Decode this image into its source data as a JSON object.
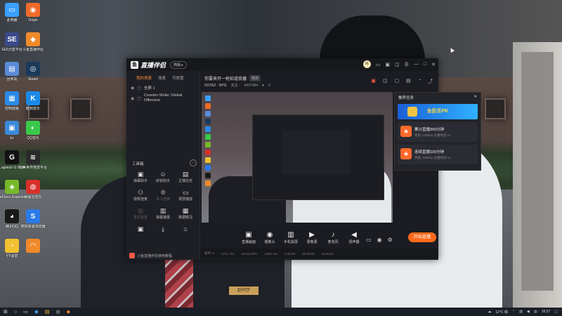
{
  "desktop_icons": [
    {
      "label": "此电脑",
      "color": "#3aa0ff",
      "glyph": "▭"
    },
    {
      "label": "Origin",
      "color": "#f06a2a",
      "glyph": "◉"
    },
    {
      "label": "SE5分盒平台",
      "color": "#3a4a8a",
      "glyph": "SE"
    },
    {
      "label": "斗鱼直播伴侣",
      "color": "#f08a2a",
      "glyph": "◆"
    },
    {
      "label": "回收站",
      "color": "#5a8ad8",
      "glyph": "▤"
    },
    {
      "label": "Steam",
      "color": "#1b3a5a",
      "glyph": "◎"
    },
    {
      "label": "控制面板",
      "color": "#2a8ae8",
      "glyph": "▦"
    },
    {
      "label": "酷狗音乐",
      "color": "#1a8ae8",
      "glyph": "K"
    },
    {
      "label": "kz",
      "color": "#3a8ad8",
      "glyph": "▣"
    },
    {
      "label": "QQ音乐",
      "color": "#3ac84a",
      "glyph": "◐"
    },
    {
      "label": "Logitech G HUB",
      "color": "#111",
      "glyph": "G"
    },
    {
      "label": "完美世界竞技平台",
      "color": "#2a2a2a",
      "glyph": "≋"
    },
    {
      "label": "GeForce Experience",
      "color": "#76b82a",
      "glyph": "◈"
    },
    {
      "label": "网易云音乐",
      "color": "#d8302a",
      "glyph": "◍"
    },
    {
      "label": "腾讯QQ",
      "color": "#1a1a1a",
      "glyph": "◕"
    },
    {
      "label": "搜狗高速浏览器",
      "color": "#2a7ae8",
      "glyph": "S"
    },
    {
      "label": "YY语音",
      "color": "#f2c030",
      "glyph": "◔"
    },
    {
      "label": "",
      "color": "#f08a2a",
      "glyph": "◠"
    }
  ],
  "app": {
    "name": "直播伴侣",
    "version_pill": "简版 ▸",
    "user_avatar": "M",
    "sidebar": {
      "tabs": [
        "我的场景",
        "场景",
        "可放置"
      ],
      "scenes": [
        {
          "label": "全屏 1"
        },
        {
          "label": "Counter-Strike: Global Offensive"
        }
      ],
      "tools_title": "工具箱",
      "tools": [
        {
          "label": "弹幕助手",
          "glyph": "▣",
          "dim": false
        },
        {
          "label": "房管助手",
          "glyph": "☺",
          "dim": false
        },
        {
          "label": "主播任务",
          "glyph": "▤",
          "dim": false
        },
        {
          "label": "视频连麦",
          "glyph": "⚇",
          "dim": false
        },
        {
          "label": "多人连麦",
          "glyph": "⚉",
          "dim": true
        },
        {
          "label": "录屏播放",
          "glyph": "▭",
          "dim": false
        },
        {
          "label": "进行投票",
          "glyph": "◎",
          "dim": true
        },
        {
          "label": "弹幕播报",
          "glyph": "▥",
          "dim": false
        },
        {
          "label": "数据概况",
          "glyph": "▦",
          "dim": false
        },
        {
          "label": "",
          "glyph": "▣",
          "dim": false
        },
        {
          "label": "",
          "glyph": "⤓",
          "dim": false
        },
        {
          "label": "",
          "glyph": "⌂",
          "dim": false
        }
      ],
      "notice": "斗鱼直播伴侣使用教程"
    },
    "main": {
      "room_title": "你要来开一枪知道我播",
      "room_tag": "修改",
      "game": "DOTA2 - RPG",
      "followers": "关注 ·",
      "fans_count": "6497384",
      "likes": "0"
    },
    "tasks": {
      "title": "推荐任务",
      "banner_text": "全民乐PK",
      "items": [
        {
          "title": "累计直播300分钟",
          "sub": "奖励: 1000xp 主播经验 x1"
        },
        {
          "title": "连续直播100分钟",
          "sub": "奖励: 1000xp 主播经验 x1"
        }
      ]
    },
    "sources": [
      {
        "label": "直播画面",
        "glyph": "▣"
      },
      {
        "label": "摄像头",
        "glyph": "◉"
      },
      {
        "label": "手机投屏",
        "glyph": "▥"
      },
      {
        "label": "录像源",
        "glyph": "▶"
      },
      {
        "label": "麦克风",
        "glyph": "♪"
      },
      {
        "label": "扬声器",
        "glyph": "◀"
      }
    ],
    "live_button": "开始直播",
    "status_bar": [
      "帧率: 0",
      "CPU: 0%",
      "0%/12:00%",
      "LDM: 0%",
      "0:00:00",
      "00:00:00",
      "00:00:01"
    ]
  },
  "taskbar": {
    "weather": "12°C 晴",
    "time": "16:27"
  }
}
